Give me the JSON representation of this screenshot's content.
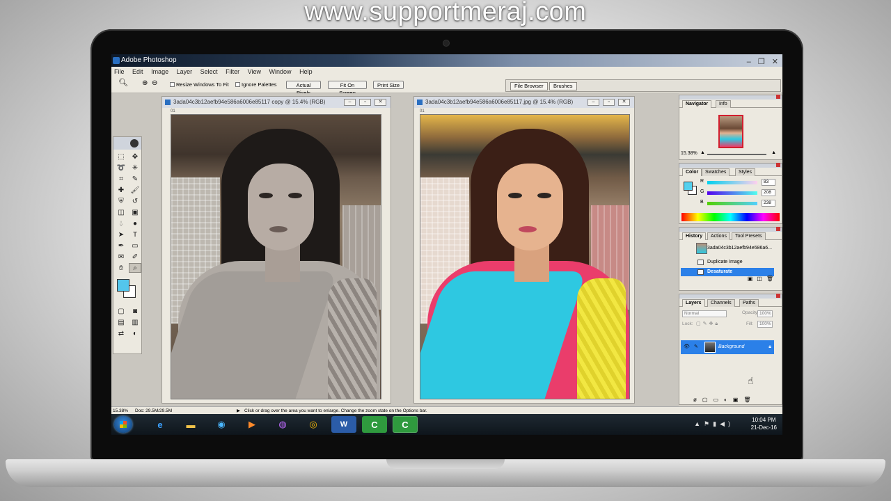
{
  "watermark": "www.supportmeraj.com",
  "app": {
    "title": "Adobe Photoshop",
    "menu": [
      "File",
      "Edit",
      "Image",
      "Layer",
      "Select",
      "Filter",
      "View",
      "Window",
      "Help"
    ]
  },
  "options_bar": {
    "resize_windows": "Resize Windows To Fit",
    "ignore_palettes": "Ignore Palettes",
    "actual_pixels": "Actual Pixels",
    "fit_on_screen": "Fit On Screen",
    "print_size": "Print Size",
    "well_tabs": [
      "File Browser",
      "Brushes"
    ]
  },
  "documents": [
    {
      "title": "3ada04c3b12aefb94e586a6006e85117 copy @ 15.4% (RGB)",
      "ruler": "01",
      "mode": "grayscale"
    },
    {
      "title": "3ada04c3b12aefb94e586a6006e85117.jpg @ 15.4% (RGB)",
      "ruler": "01",
      "mode": "color"
    }
  ],
  "navigator": {
    "tabs": [
      "Navigator",
      "Info"
    ],
    "zoom": "15.38%"
  },
  "color": {
    "tabs": [
      "Color",
      "Swatches",
      "Styles"
    ],
    "channels": [
      {
        "label": "R",
        "value": "83"
      },
      {
        "label": "G",
        "value": "208"
      },
      {
        "label": "B",
        "value": "238"
      }
    ],
    "foreground": "#53d0ee"
  },
  "history": {
    "tabs": [
      "History",
      "Actions",
      "Tool Presets"
    ],
    "snapshot": "3ada04c3b12aefb94e586a6...",
    "items": [
      "Duplicate Image",
      "Desaturate"
    ]
  },
  "layers": {
    "tabs": [
      "Layers",
      "Channels",
      "Paths"
    ],
    "blend": "Normal",
    "opacity_label": "Opacity:",
    "opacity": "100%",
    "lock_label": "Lock:",
    "fill_label": "Fill:",
    "fill": "100%",
    "layer_name": "Background"
  },
  "status": {
    "zoom": "15.38%",
    "doc": "Doc: 29.5M/29.5M",
    "hint": "Click or drag over the area you want to enlarge. Change the zoom state on the Options bar."
  },
  "taskbar": {
    "apps": [
      "ie-icon",
      "folder-icon",
      "media-center-icon",
      "media-player-icon",
      "photoshop-icon",
      "chrome-icon",
      "word-icon",
      "camtasia-icon",
      "camtasia-recorder-icon"
    ],
    "time": "10:04 PM",
    "date": "21-Dec-16"
  },
  "colors": {
    "accent_blue": "#2b80e8",
    "foreground_swatch": "#53c6ec"
  }
}
